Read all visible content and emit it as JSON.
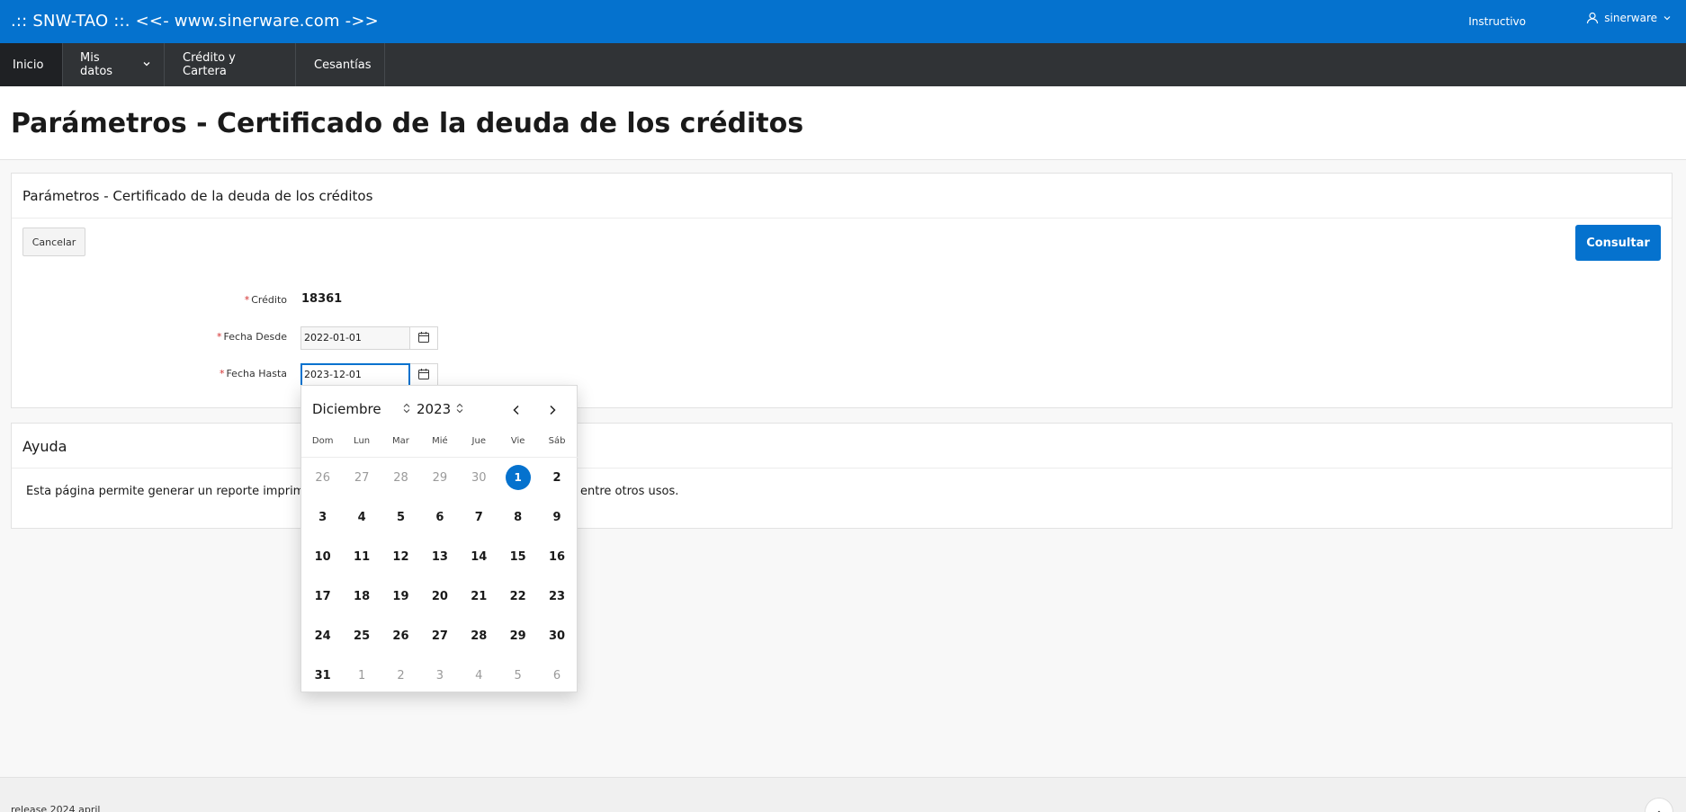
{
  "app": {
    "title": ".:: SNW-TAO ::. <<- www.sinerware.com ->>",
    "instructivo": "Instructivo",
    "username": "sinerware"
  },
  "nav": [
    {
      "label": "Inicio",
      "active": true
    },
    {
      "label": "Mis datos",
      "has_dropdown": true
    },
    {
      "label": "Crédito y Cartera"
    },
    {
      "label": "Cesantías"
    }
  ],
  "page": {
    "title": "Parámetros - Certificado de la deuda de los créditos"
  },
  "params_region": {
    "title": "Parámetros - Certificado de la deuda de los créditos",
    "cancel_label": "Cancelar",
    "submit_label": "Consultar",
    "credito_label": "Crédito",
    "credito_value": "18361",
    "fecha_desde_label": "Fecha Desde",
    "fecha_desde_value": "2022-01-01",
    "fecha_hasta_label": "Fecha Hasta",
    "fecha_hasta_value": "2023-12-01",
    "required_marker": "*"
  },
  "help_region": {
    "title": "Ayuda",
    "text_start": "Esta página permite generar un reporte imprimible",
    "text_end": "entre otros usos."
  },
  "datepicker": {
    "month": "Diciembre",
    "year": "2023",
    "weekdays": [
      "Dom",
      "Lun",
      "Mar",
      "Mié",
      "Jue",
      "Vie",
      "Sáb"
    ],
    "weeks": [
      [
        "26",
        "27",
        "28",
        "29",
        "30",
        "1",
        "2"
      ],
      [
        "3",
        "4",
        "5",
        "6",
        "7",
        "8",
        "9"
      ],
      [
        "10",
        "11",
        "12",
        "13",
        "14",
        "15",
        "16"
      ],
      [
        "17",
        "18",
        "19",
        "20",
        "21",
        "22",
        "23"
      ],
      [
        "24",
        "25",
        "26",
        "27",
        "28",
        "29",
        "30"
      ],
      [
        "31",
        "1",
        "2",
        "3",
        "4",
        "5",
        "6"
      ]
    ],
    "selected_day": "1"
  },
  "footer": {
    "release": "release 2024 april"
  },
  "colors": {
    "primary": "#0572ce",
    "navbar": "#303336",
    "required": "#d32f2f"
  }
}
